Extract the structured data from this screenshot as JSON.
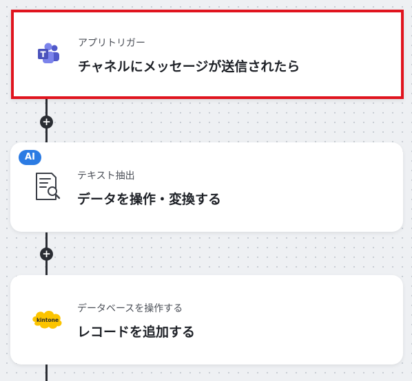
{
  "connector": {
    "plus_symbol": "+"
  },
  "steps": [
    {
      "subtitle": "アプリトリガー",
      "title": "チャネルにメッセージが送信されたら",
      "icon": "microsoft-teams-icon",
      "highlighted": true,
      "highlight_color": "#e0141e"
    },
    {
      "badge": "AI",
      "subtitle": "テキスト抽出",
      "title": "データを操作・変換する",
      "icon": "document-search-icon"
    },
    {
      "subtitle": "データベースを操作する",
      "title": "レコードを追加する",
      "icon": "kintone-logo-icon",
      "logo_text": "kintone"
    }
  ],
  "colors": {
    "accent_blue": "#2b7be3",
    "teams_purple": "#5059c9",
    "kintone_yellow": "#fcc400",
    "connector_dark": "#2a2d33"
  }
}
